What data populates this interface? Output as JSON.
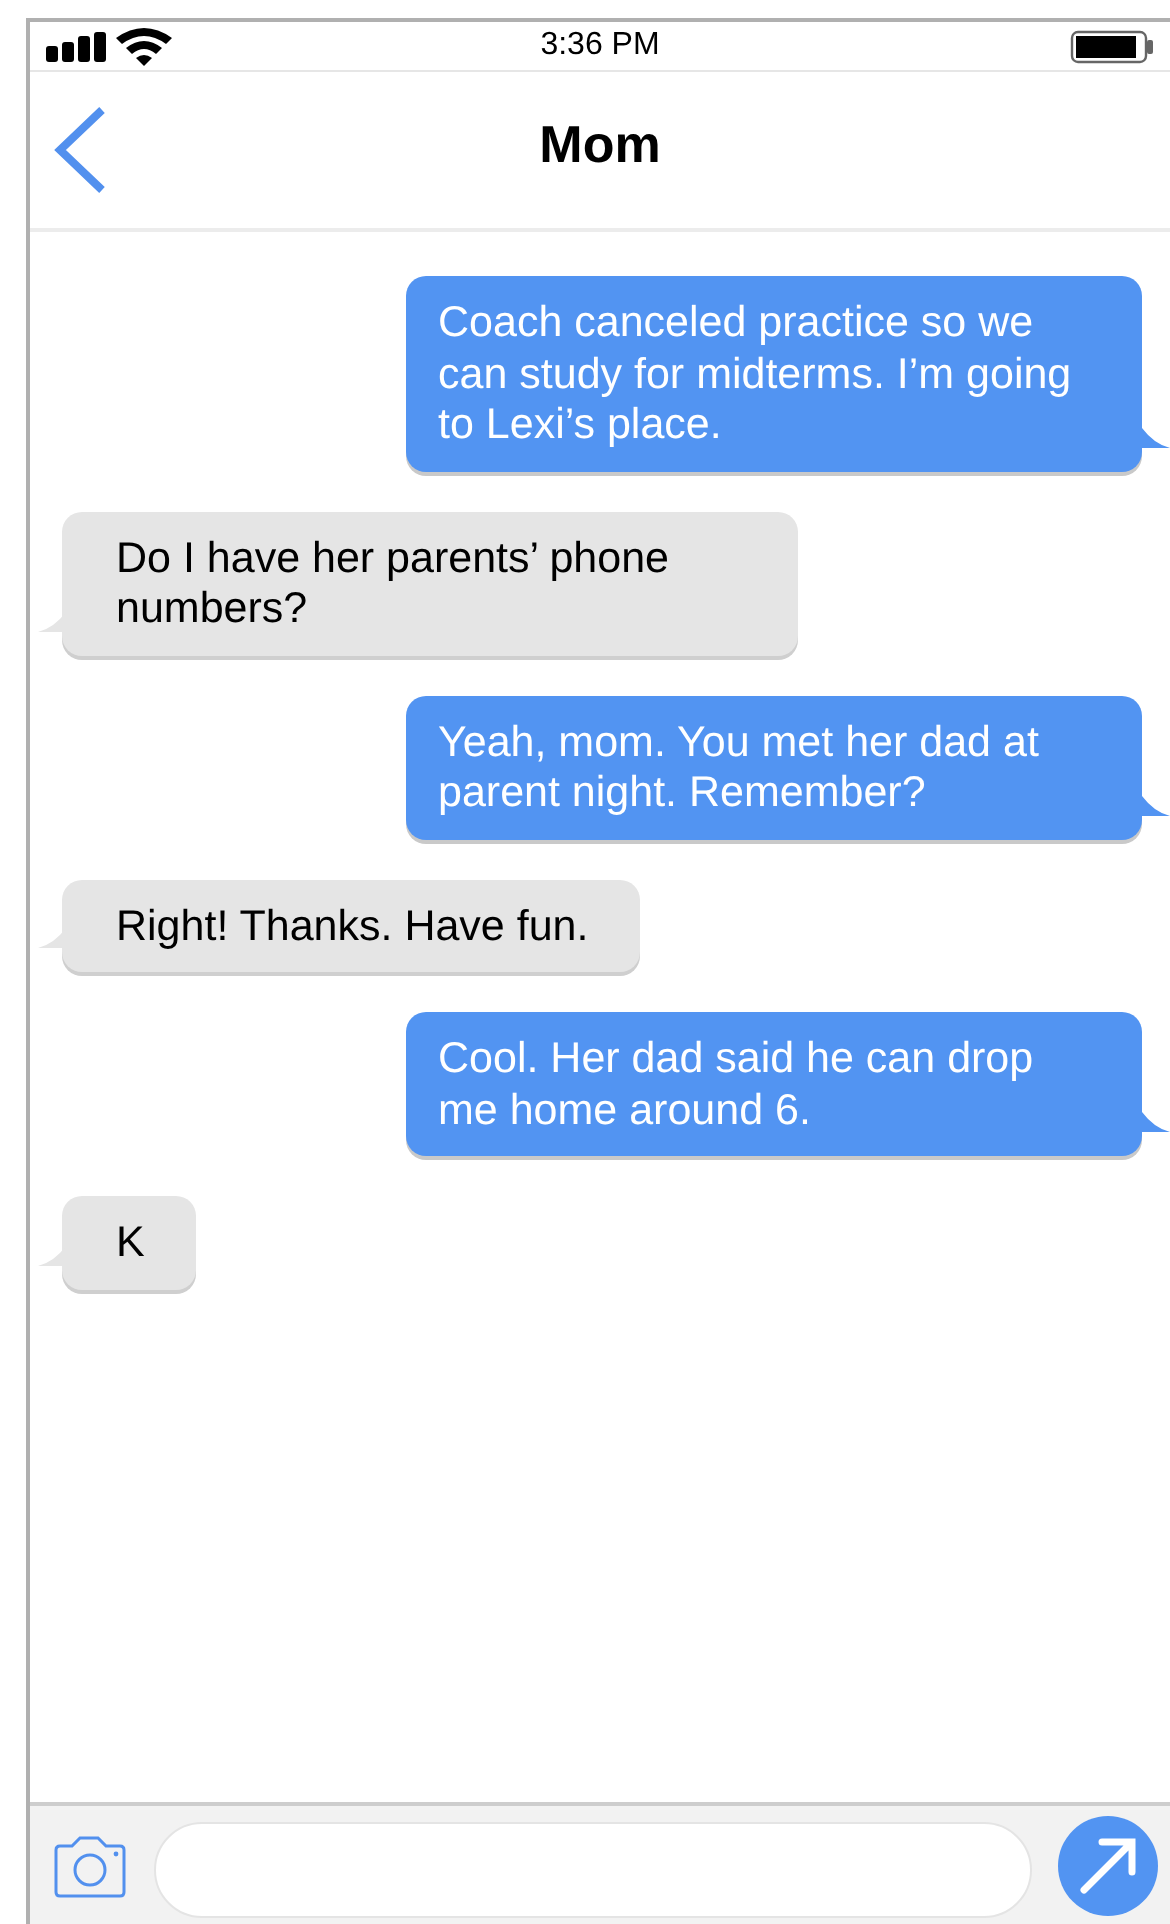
{
  "status_bar": {
    "time": "3:36 PM"
  },
  "header": {
    "title": "Mom"
  },
  "messages": [
    {
      "kind": "sent",
      "text": "Coach canceled practice so we can study for midterms. I’m going to Lexi’s place."
    },
    {
      "kind": "received",
      "text": "Do I have her parents’ phone numbers?"
    },
    {
      "kind": "sent",
      "text": "Yeah, mom. You met her dad at parent night. Remember?"
    },
    {
      "kind": "received",
      "text": "Right! Thanks. Have fun."
    },
    {
      "kind": "sent",
      "text": "Cool. Her dad said he can drop me home around 6."
    },
    {
      "kind": "received",
      "text": "K"
    }
  ]
}
